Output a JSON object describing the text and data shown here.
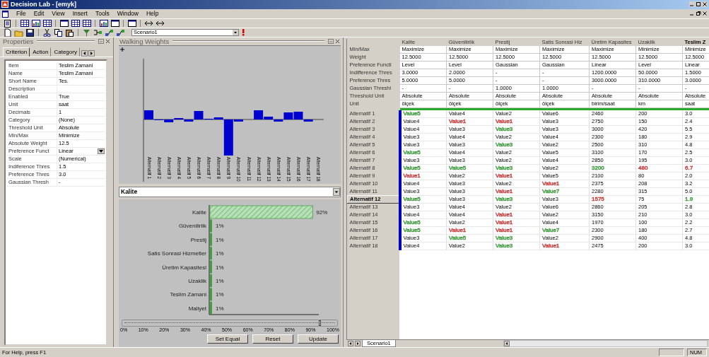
{
  "window": {
    "title": "Decision Lab - [emyk]"
  },
  "menu": [
    "File",
    "Edit",
    "View",
    "Insert",
    "Tools",
    "Window",
    "Help"
  ],
  "toolbar": {
    "scenario": "Scenario1"
  },
  "properties": {
    "title": "Properties",
    "tabs": [
      {
        "label": "Criterion",
        "selected": true
      },
      {
        "label": "Action",
        "selected": false
      },
      {
        "label": "Category",
        "selected": false
      }
    ],
    "rows": [
      {
        "name": "Item",
        "value": "Teslim Zamani",
        "kind": "text"
      },
      {
        "name": "Name",
        "value": "Teslim Zamani",
        "kind": "text"
      },
      {
        "name": "Short Name",
        "value": "Tes.",
        "kind": "text"
      },
      {
        "name": "Description",
        "kind": "text"
      },
      {
        "name": "Enabled",
        "value": "True",
        "kind": "text"
      },
      {
        "name": "Unit",
        "value": "saat",
        "kind": "text"
      },
      {
        "name": "Decimals",
        "value": "1",
        "kind": "text"
      },
      {
        "name": "Category",
        "value": "(None)",
        "kind": "text"
      },
      {
        "name": "Threshold Unit",
        "value": "Absolute",
        "kind": "text"
      },
      {
        "name": "Min/Max",
        "value": "Minimize",
        "kind": "text"
      },
      {
        "name": "Absolute Weight",
        "value": "12.5",
        "kind": "text"
      },
      {
        "name": "Preference Funct",
        "value": "Linear",
        "kind": "dropdown"
      },
      {
        "name": "Scale",
        "value": "(Numerical)",
        "kind": "text"
      },
      {
        "name": "Indiference Thres",
        "value": "1.5",
        "kind": "text"
      },
      {
        "name": "Preference Thres",
        "value": "3.0",
        "kind": "text"
      },
      {
        "name": "Gaussian Thresh",
        "value": "-",
        "kind": "text"
      }
    ]
  },
  "walking_weights": {
    "title": "Walking Weights",
    "bar_labels": [
      "Alternatif 1",
      "Alternatif 2",
      "Alternatif 3",
      "Alternatif 4",
      "Alternatif 5",
      "Alternatif 6",
      "Alternatif 7",
      "Alternatif 8",
      "Alternatif 9",
      "Alternatif 10",
      "Alternatif 11",
      "Alternatif 12",
      "Alternatif 13",
      "Alternatif 14",
      "Alternatif 15",
      "Alternatif 16",
      "Alternatif 17",
      "Alternatif 18"
    ],
    "criterion": "Kalite",
    "chart_data": {
      "type": "bar",
      "orientation": "horizontal",
      "categories": [
        "Kalite",
        "Güvenilirlik",
        "Prestij",
        "Satis Sonrasi Hizmetler",
        "Üretim Kapasitesi",
        "Uzaklik",
        "Teslim Zamani",
        "Maliyet"
      ],
      "values": [
        92,
        1,
        1,
        1,
        1,
        1,
        1,
        1
      ],
      "value_labels": [
        "92%",
        "1%",
        "1%",
        "1%",
        "1%",
        "1%",
        "1%",
        "1%"
      ]
    },
    "slider": {
      "level": 0.92,
      "ticks": [
        "0%",
        "10%",
        "20%",
        "30%",
        "40%",
        "50%",
        "60%",
        "70%",
        "80%",
        "90%",
        "100%"
      ]
    },
    "buttons": [
      "Set Equal",
      "Reset",
      "Update"
    ]
  },
  "table": {
    "columns": [
      {
        "label": "Kalite",
        "selected": false
      },
      {
        "label": "Güvenilirlik",
        "selected": false
      },
      {
        "label": "Prestij",
        "selected": false
      },
      {
        "label": "Satis Sonrasi Hiz",
        "selected": false
      },
      {
        "label": "Üretim Kapasites",
        "selected": false
      },
      {
        "label": "Uzaklik",
        "selected": false
      },
      {
        "label": "Teslim Z",
        "selected": true
      }
    ],
    "property_rows": [
      {
        "label": "Min/Max",
        "cells": [
          "Maximize",
          "Maximize",
          "Maximize",
          "Maximize",
          "Maximize",
          "Minimize",
          "Minimize"
        ]
      },
      {
        "label": "Weight",
        "cells": [
          "12.5000",
          "12.5000",
          "12.5000",
          "12.5000",
          "12.5000",
          "12.5000",
          "12.5000"
        ]
      },
      {
        "label": "Preference Functi",
        "cells": [
          "Level",
          "Level",
          "Gaussian",
          "Gaussian",
          "Linear",
          "Level",
          "Linear"
        ]
      },
      {
        "label": "Indifference Thres",
        "cells": [
          "3.0000",
          "2.0000",
          "-",
          "-",
          "1200.0000",
          "50.0000",
          "1.5000"
        ]
      },
      {
        "label": "Preference Thres",
        "cells": [
          "5.0000",
          "5.0000",
          "-",
          "-",
          "3000.0000",
          "310.0000",
          "3.0000"
        ]
      },
      {
        "label": "Gaussian Threshi",
        "cells": [
          "-",
          "-",
          "1.0000",
          "1.0000",
          "-",
          "-",
          "-"
        ]
      },
      {
        "label": "Threshold Unit",
        "cells": [
          "Absolute",
          "Absolute",
          "Absolute",
          "Absolute",
          "Absolute",
          "Absolute",
          "Absolute"
        ]
      },
      {
        "label": "Unit",
        "cells": [
          "ölçek",
          "ölçek",
          "ölçek",
          "ölçek",
          "birim/saat",
          "km",
          "saat"
        ]
      }
    ],
    "rows": [
      {
        "label": "Alternatif 1",
        "selected": false,
        "cells": [
          {
            "text": "Value5",
            "color": "#3c9a3c"
          },
          "Value4",
          "Value2",
          "Value6",
          "2460",
          "200",
          "3.0"
        ]
      },
      {
        "label": "Alternatif 2",
        "selected": false,
        "cells": [
          "Value4",
          {
            "text": "Value1",
            "color": "#c83c3c"
          },
          {
            "text": "Value1",
            "color": "#c83c3c"
          },
          "Value3",
          "2750",
          "150",
          "2.4"
        ]
      },
      {
        "label": "Alternatif 3",
        "selected": false,
        "cells": [
          "Value4",
          "Value3",
          {
            "text": "Value3",
            "color": "#3c9a3c"
          },
          "Value3",
          "3000",
          "420",
          "5.5"
        ]
      },
      {
        "label": "Alternatif 4",
        "selected": false,
        "cells": [
          "Value3",
          "Value4",
          "Value2",
          "Value4",
          "2300",
          "180",
          "2.9"
        ]
      },
      {
        "label": "Alternatif 5",
        "selected": false,
        "cells": [
          "Value3",
          "Value3",
          {
            "text": "Value3",
            "color": "#3c9a3c"
          },
          "Value2",
          "2500",
          "310",
          "4.8"
        ]
      },
      {
        "label": "Alternatif 6",
        "selected": false,
        "cells": [
          {
            "text": "Value5",
            "color": "#3c9a3c"
          },
          "Value4",
          "Value2",
          "Value5",
          "3100",
          "170",
          "2.5"
        ]
      },
      {
        "label": "Alternatif 7",
        "selected": false,
        "cells": [
          "Value3",
          "Value3",
          "Value2",
          "Value4",
          "2850",
          "195",
          "3.0"
        ]
      },
      {
        "label": "Alternatif 8",
        "selected": false,
        "cells": [
          {
            "text": "Value5",
            "color": "#3c9a3c"
          },
          {
            "text": "Value5",
            "color": "#3c9a3c"
          },
          {
            "text": "Value3",
            "color": "#3c9a3c"
          },
          "Value2",
          {
            "text": "3200",
            "color": "#3c9a3c"
          },
          {
            "text": "480",
            "color": "#c83c3c"
          },
          {
            "text": "6.7",
            "color": "#c83c3c"
          }
        ]
      },
      {
        "label": "Alternatif 9",
        "selected": false,
        "cells": [
          {
            "text": "Value1",
            "color": "#c83c3c"
          },
          "Value2",
          {
            "text": "Value1",
            "color": "#c83c3c"
          },
          "Value5",
          "2100",
          "80",
          "2.0"
        ]
      },
      {
        "label": "Alternatif 10",
        "selected": false,
        "cells": [
          "Value4",
          "Value3",
          "Value2",
          {
            "text": "Value1",
            "color": "#c83c3c"
          },
          "2375",
          "208",
          "3.2"
        ]
      },
      {
        "label": "Alternatif 11",
        "selected": false,
        "cells": [
          "Value3",
          "Value3",
          {
            "text": "Value1",
            "color": "#c83c3c"
          },
          {
            "text": "Value7",
            "color": "#3c9a3c"
          },
          "2280",
          "315",
          "5.0"
        ]
      },
      {
        "label": "Alternatif 12",
        "selected": true,
        "cells": [
          {
            "text": "Value5",
            "color": "#3c9a3c"
          },
          "Value3",
          {
            "text": "Value3",
            "color": "#3c9a3c"
          },
          "Value3",
          {
            "text": "1575",
            "color": "#c83c3c"
          },
          "75",
          {
            "text": "1.9",
            "color": "#3c9a3c"
          }
        ]
      },
      {
        "label": "Alternatif 13",
        "selected": false,
        "cells": [
          "Value3",
          "Value4",
          "Value2",
          "Value6",
          "2860",
          "205",
          "2.8"
        ]
      },
      {
        "label": "Alternatif 14",
        "selected": false,
        "cells": [
          "Value4",
          "Value4",
          {
            "text": "Value1",
            "color": "#c83c3c"
          },
          "Value2",
          "3150",
          "210",
          "3.0"
        ]
      },
      {
        "label": "Alternatif 15",
        "selected": false,
        "cells": [
          {
            "text": "Value5",
            "color": "#3c9a3c"
          },
          "Value2",
          {
            "text": "Value1",
            "color": "#c83c3c"
          },
          "Value4",
          "1970",
          "100",
          "2.2"
        ]
      },
      {
        "label": "Alternatif 16",
        "selected": false,
        "cells": [
          {
            "text": "Value5",
            "color": "#3c9a3c"
          },
          {
            "text": "Value1",
            "color": "#c83c3c"
          },
          {
            "text": "Value1",
            "color": "#c83c3c"
          },
          {
            "text": "Value7",
            "color": "#3c9a3c"
          },
          "2300",
          "180",
          "2.7"
        ]
      },
      {
        "label": "Alternatif 17",
        "selected": false,
        "cells": [
          "Value3",
          {
            "text": "Value5",
            "color": "#3c9a3c"
          },
          {
            "text": "Value3",
            "color": "#3c9a3c"
          },
          "Value2",
          "2900",
          "400",
          "4.8"
        ]
      },
      {
        "label": "Alternatif 18",
        "selected": false,
        "cells": [
          "Value4",
          "Value2",
          {
            "text": "Value3",
            "color": "#3c9a3c"
          },
          {
            "text": "Value1",
            "color": "#c83c3c"
          },
          "2475",
          "200",
          "3.0"
        ]
      }
    ]
  },
  "sheet_tabs": [
    {
      "label": "Scenario1",
      "selected": true
    }
  ],
  "status_bar": {
    "text": "For Help, press F1",
    "indicator": "NUM"
  }
}
